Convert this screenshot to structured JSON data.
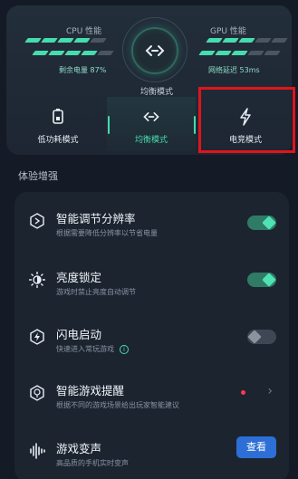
{
  "header": {
    "cpu": {
      "title": "CPU 性能",
      "subtitle": "剩余电量 87%",
      "level_segments": 4,
      "total_segments": 5
    },
    "gpu": {
      "title": "GPU 性能",
      "subtitle": "网络延迟 53ms",
      "level_segments": 3,
      "total_segments": 5
    },
    "current_mode": "均衡模式"
  },
  "modes": [
    {
      "label": "低功耗模式",
      "icon": "battery-icon",
      "active": false
    },
    {
      "label": "均衡模式",
      "icon": "balance-icon",
      "active": true
    },
    {
      "label": "电竞模式",
      "icon": "lightning-icon",
      "active": false
    }
  ],
  "section": {
    "title": "体验增强"
  },
  "features": [
    {
      "title": "智能调节分辨率",
      "desc": "根据需要降低分辨率以节省电量",
      "icon": "resolution-icon",
      "control": "switch",
      "state": "on"
    },
    {
      "title": "亮度锁定",
      "desc": "游戏时禁止亮度自动调节",
      "icon": "brightness-icon",
      "control": "switch",
      "state": "on"
    },
    {
      "title": "闪电启动",
      "desc": "快速进入常玩游戏",
      "icon": "lightning-icon",
      "control": "switch",
      "state": "off",
      "info": "i"
    },
    {
      "title": "智能游戏提醒",
      "desc": "根据不同的游戏场景给出玩家智能建议",
      "icon": "brain-icon",
      "control": "chevron",
      "badge": "new-dot",
      "chevron": "›"
    },
    {
      "title": "游戏变声",
      "desc": "高品质的手机实时变声",
      "icon": "voice-wave-icon",
      "control": "button",
      "button_label": "查看"
    }
  ],
  "colors": {
    "accent": "#47dcae",
    "background": "#141b26",
    "panel": "#1c2430",
    "highlight": "#e1141c",
    "button": "#2d6fd7"
  }
}
